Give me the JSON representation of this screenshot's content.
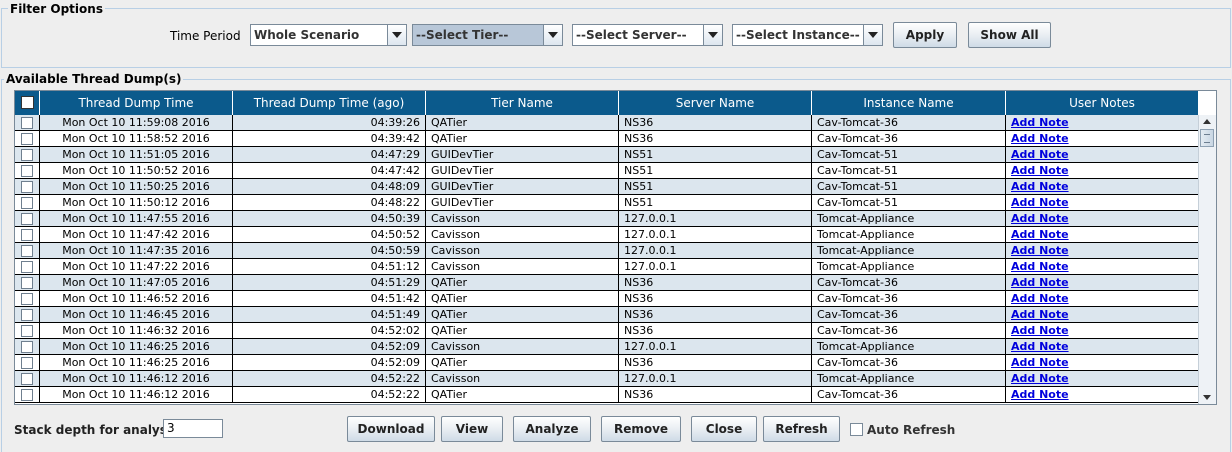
{
  "filter": {
    "title": "Filter Options",
    "time_period_label": "Time Period",
    "time_period_value": "Whole Scenario",
    "tier_value": "--Select Tier--",
    "server_value": "--Select Server--",
    "instance_value": "--Select Instance--",
    "apply_label": "Apply",
    "show_all_label": "Show All"
  },
  "table": {
    "title": "Available Thread Dump(s)",
    "columns": [
      "Thread Dump Time",
      "Thread Dump Time (ago)",
      "Tier Name",
      "Server Name",
      "Instance Name",
      "User Notes"
    ],
    "rows": [
      {
        "time": "Mon Oct 10 11:59:08 2016",
        "ago": "04:39:26",
        "tier": "QATier",
        "server": "NS36",
        "instance": "Cav-Tomcat-36",
        "note": "Add Note"
      },
      {
        "time": "Mon Oct 10 11:58:52 2016",
        "ago": "04:39:42",
        "tier": "QATier",
        "server": "NS36",
        "instance": "Cav-Tomcat-36",
        "note": "Add Note"
      },
      {
        "time": "Mon Oct 10 11:51:05 2016",
        "ago": "04:47:29",
        "tier": "GUIDevTier",
        "server": "NS51",
        "instance": "Cav-Tomcat-51",
        "note": "Add Note"
      },
      {
        "time": "Mon Oct 10 11:50:52 2016",
        "ago": "04:47:42",
        "tier": "GUIDevTier",
        "server": "NS51",
        "instance": "Cav-Tomcat-51",
        "note": "Add Note"
      },
      {
        "time": "Mon Oct 10 11:50:25 2016",
        "ago": "04:48:09",
        "tier": "GUIDevTier",
        "server": "NS51",
        "instance": "Cav-Tomcat-51",
        "note": "Add Note"
      },
      {
        "time": "Mon Oct 10 11:50:12 2016",
        "ago": "04:48:22",
        "tier": "GUIDevTier",
        "server": "NS51",
        "instance": "Cav-Tomcat-51",
        "note": "Add Note"
      },
      {
        "time": "Mon Oct 10 11:47:55 2016",
        "ago": "04:50:39",
        "tier": "Cavisson",
        "server": "127.0.0.1",
        "instance": "Tomcat-Appliance",
        "note": "Add Note"
      },
      {
        "time": "Mon Oct 10 11:47:42 2016",
        "ago": "04:50:52",
        "tier": "Cavisson",
        "server": "127.0.0.1",
        "instance": "Tomcat-Appliance",
        "note": "Add Note"
      },
      {
        "time": "Mon Oct 10 11:47:35 2016",
        "ago": "04:50:59",
        "tier": "Cavisson",
        "server": "127.0.0.1",
        "instance": "Tomcat-Appliance",
        "note": "Add Note"
      },
      {
        "time": "Mon Oct 10 11:47:22 2016",
        "ago": "04:51:12",
        "tier": "Cavisson",
        "server": "127.0.0.1",
        "instance": "Tomcat-Appliance",
        "note": "Add Note"
      },
      {
        "time": "Mon Oct 10 11:47:05 2016",
        "ago": "04:51:29",
        "tier": "QATier",
        "server": "NS36",
        "instance": "Cav-Tomcat-36",
        "note": "Add Note"
      },
      {
        "time": "Mon Oct 10 11:46:52 2016",
        "ago": "04:51:42",
        "tier": "QATier",
        "server": "NS36",
        "instance": "Cav-Tomcat-36",
        "note": "Add Note"
      },
      {
        "time": "Mon Oct 10 11:46:45 2016",
        "ago": "04:51:49",
        "tier": "QATier",
        "server": "NS36",
        "instance": "Cav-Tomcat-36",
        "note": "Add Note"
      },
      {
        "time": "Mon Oct 10 11:46:32 2016",
        "ago": "04:52:02",
        "tier": "QATier",
        "server": "NS36",
        "instance": "Cav-Tomcat-36",
        "note": "Add Note"
      },
      {
        "time": "Mon Oct 10 11:46:25 2016",
        "ago": "04:52:09",
        "tier": "Cavisson",
        "server": "127.0.0.1",
        "instance": "Tomcat-Appliance",
        "note": "Add Note"
      },
      {
        "time": "Mon Oct 10 11:46:25 2016",
        "ago": "04:52:09",
        "tier": "QATier",
        "server": "NS36",
        "instance": "Cav-Tomcat-36",
        "note": "Add Note"
      },
      {
        "time": "Mon Oct 10 11:46:12 2016",
        "ago": "04:52:22",
        "tier": "Cavisson",
        "server": "127.0.0.1",
        "instance": "Tomcat-Appliance",
        "note": "Add Note"
      },
      {
        "time": "Mon Oct 10 11:46:12 2016",
        "ago": "04:52:22",
        "tier": "QATier",
        "server": "NS36",
        "instance": "Cav-Tomcat-36",
        "note": "Add Note"
      }
    ]
  },
  "footer": {
    "stack_depth_label": "Stack depth for analysis:",
    "stack_depth_value": "3",
    "download_label": "Download",
    "view_label": "View",
    "analyze_label": "Analyze",
    "remove_label": "Remove",
    "close_label": "Close",
    "refresh_label": "Refresh",
    "auto_refresh_label": "Auto Refresh"
  },
  "colors": {
    "header_bg": "#0b5a8c",
    "row_alt_bg": "#dce6ee",
    "link": "#0000dd"
  }
}
